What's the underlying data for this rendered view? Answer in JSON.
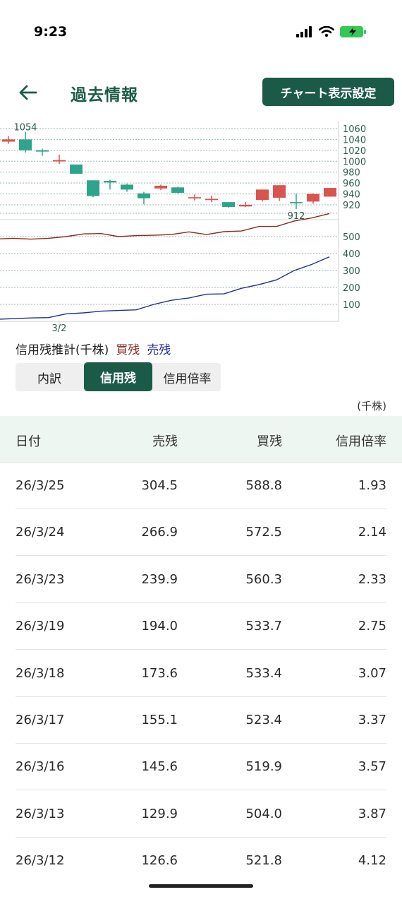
{
  "status_bar": {
    "time": "9:23"
  },
  "header": {
    "title": "過去情報",
    "chart_settings_label": "チャート表示設定"
  },
  "chart": {
    "price_axis_labels": [
      "1060",
      "1040",
      "1020",
      "1000",
      "980",
      "960",
      "940",
      "920"
    ],
    "volume_axis_labels": [
      "500",
      "400",
      "300",
      "200",
      "100"
    ],
    "date_label": "3/2",
    "high_annotation": "1054",
    "low_annotation": "912",
    "candles": [
      {
        "open": 1036,
        "close": 1040,
        "high": 1046,
        "low": 1032
      },
      {
        "open": 1040,
        "close": 1020,
        "high": 1054,
        "low": 1016
      },
      {
        "open": 1020,
        "close": 1019,
        "high": 1023,
        "low": 1010
      },
      {
        "open": 1001,
        "close": 1002,
        "high": 1012,
        "low": 995
      },
      {
        "open": 994,
        "close": 977,
        "high": 994,
        "low": 977
      },
      {
        "open": 965,
        "close": 936,
        "high": 965,
        "low": 934
      },
      {
        "open": 964,
        "close": 961,
        "high": 966,
        "low": 948
      },
      {
        "open": 957,
        "close": 948,
        "high": 959,
        "low": 944
      },
      {
        "open": 941,
        "close": 932,
        "high": 944,
        "low": 921
      },
      {
        "open": 950,
        "close": 955,
        "high": 957,
        "low": 947
      },
      {
        "open": 952,
        "close": 942,
        "high": 953,
        "low": 941
      },
      {
        "open": 934,
        "close": 934,
        "high": 939,
        "low": 928
      },
      {
        "open": 931,
        "close": 931,
        "high": 937,
        "low": 925
      },
      {
        "open": 925,
        "close": 916,
        "high": 925,
        "low": 915
      },
      {
        "open": 917,
        "close": 920,
        "high": 925,
        "low": 916
      },
      {
        "open": 929,
        "close": 948,
        "high": 948,
        "low": 926
      },
      {
        "open": 933,
        "close": 956,
        "high": 956,
        "low": 927
      },
      {
        "open": 925,
        "close": 924,
        "high": 941,
        "low": 912
      },
      {
        "open": 926,
        "close": 940,
        "high": 941,
        "low": 922
      },
      {
        "open": 935,
        "close": 951,
        "high": 951,
        "low": 935
      }
    ],
    "buy_line": [
      486,
      490,
      485,
      490,
      500,
      516,
      518,
      500,
      506,
      508,
      512,
      528,
      512,
      529,
      533,
      560,
      560,
      592,
      610,
      636
    ],
    "sell_line": [
      12,
      16,
      20,
      22,
      44,
      50,
      60,
      64,
      68,
      100,
      124,
      138,
      160,
      162,
      195,
      217,
      245,
      300,
      336,
      381
    ]
  },
  "legend": {
    "base": "信用残推計(千株)",
    "buy": "買残",
    "sell": "売残"
  },
  "segments": [
    "内訳",
    "信用残",
    "信用倍率"
  ],
  "active_segment": "信用残",
  "unit": "(千株)",
  "table": {
    "headers": [
      "日付",
      "売残",
      "買残",
      "信用倍率"
    ],
    "rows": [
      [
        "26/3/25",
        "304.5",
        "588.8",
        "1.93"
      ],
      [
        "26/3/24",
        "266.9",
        "572.5",
        "2.14"
      ],
      [
        "26/3/23",
        "239.9",
        "560.3",
        "2.33"
      ],
      [
        "26/3/19",
        "194.0",
        "533.7",
        "2.75"
      ],
      [
        "26/3/18",
        "173.6",
        "533.4",
        "3.07"
      ],
      [
        "26/3/17",
        "155.1",
        "523.4",
        "3.37"
      ],
      [
        "26/3/16",
        "145.6",
        "519.9",
        "3.57"
      ],
      [
        "26/3/13",
        "129.9",
        "504.0",
        "3.87"
      ],
      [
        "26/3/12",
        "126.6",
        "521.8",
        "4.12"
      ]
    ]
  },
  "colors": {
    "brand_green": "#1b5a47",
    "up_candle": "#d9534f",
    "down_candle": "#2ea58a",
    "buy_line": "#8b2a23",
    "sell_line": "#22308a"
  }
}
